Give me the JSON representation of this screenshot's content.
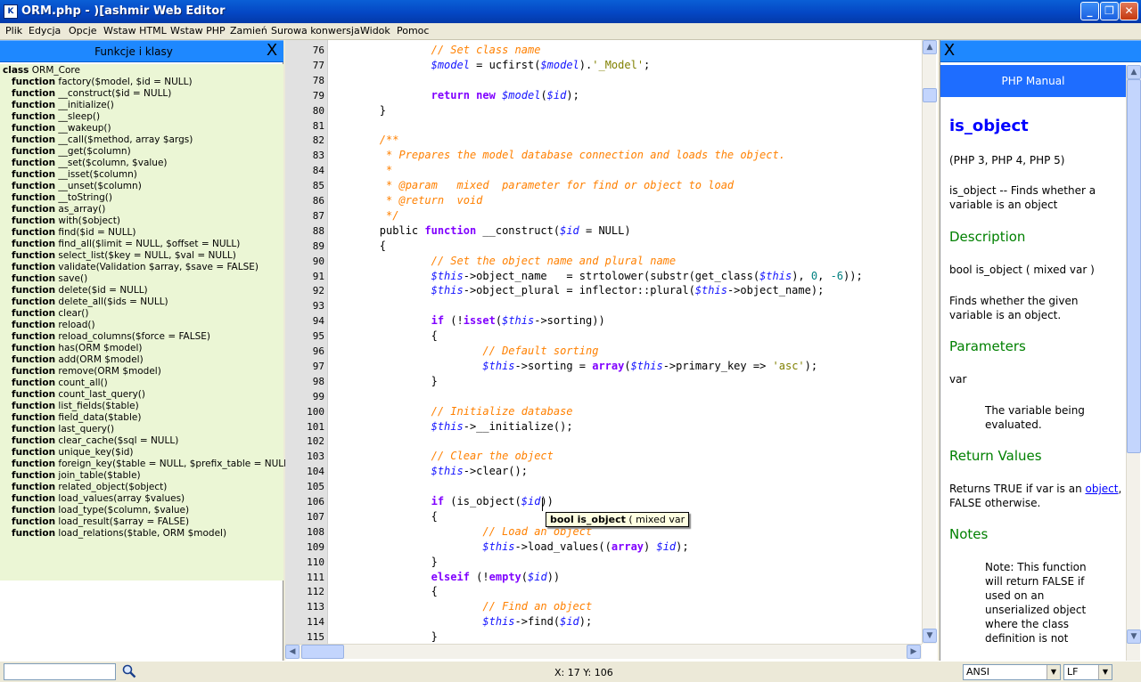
{
  "window": {
    "title": "ORM.php - )[ashmir Web Editor",
    "app_icon": "K",
    "minimize": "_",
    "maximize": "❐",
    "close": "✕"
  },
  "menu": [
    "Plik",
    "Edycja",
    "Opcje",
    "Wstaw HTML",
    "Wstaw PHP",
    "Zamień",
    "Surowa konwersja",
    "Widok",
    "Pomoc"
  ],
  "left_panel": {
    "title": "Funkcje i klasy",
    "close": "X",
    "class_keyword": "class",
    "class_name": "ORM_Core",
    "function_keyword": "function",
    "functions": [
      "factory($model, $id = NULL)",
      "__construct($id = NULL)",
      "__initialize()",
      "__sleep()",
      "__wakeup()",
      "__call($method, array $args)",
      "__get($column)",
      "__set($column, $value)",
      "__isset($column)",
      "__unset($column)",
      "__toString()",
      "as_array()",
      "with($object)",
      "find($id = NULL)",
      "find_all($limit = NULL, $offset = NULL)",
      "select_list($key = NULL, $val = NULL)",
      "validate(Validation $array, $save = FALSE)",
      "save()",
      "delete($id = NULL)",
      "delete_all($ids = NULL)",
      "clear()",
      "reload()",
      "reload_columns($force = FALSE)",
      "has(ORM $model)",
      "add(ORM $model)",
      "remove(ORM $model)",
      "count_all()",
      "count_last_query()",
      "list_fields($table)",
      "field_data($table)",
      "last_query()",
      "clear_cache($sql = NULL)",
      "unique_key($id)",
      "foreign_key($table = NULL, $prefix_table = NULL)",
      "join_table($table)",
      "related_object($object)",
      "load_values(array $values)",
      "load_type($column, $value)",
      "load_result($array = FALSE)",
      "load_relations($table, ORM $model)"
    ]
  },
  "editor": {
    "lines": [
      {
        "n": "76",
        "t": [
          [
            "cmt",
            "                // Set class name"
          ]
        ]
      },
      {
        "n": "77",
        "t": [
          [
            "p",
            "                "
          ],
          [
            "var",
            "$model"
          ],
          [
            "p",
            " = ucfirst("
          ],
          [
            "var",
            "$model"
          ],
          [
            "p",
            ")."
          ],
          [
            "str",
            "'_Model'"
          ],
          [
            "p",
            ";"
          ]
        ]
      },
      {
        "n": "78",
        "t": []
      },
      {
        "n": "79",
        "t": [
          [
            "p",
            "                "
          ],
          [
            "kw",
            "return new"
          ],
          [
            "p",
            " "
          ],
          [
            "var",
            "$model"
          ],
          [
            "p",
            "("
          ],
          [
            "var",
            "$id"
          ],
          [
            "p",
            ");"
          ]
        ]
      },
      {
        "n": "80",
        "t": [
          [
            "p",
            "        }"
          ]
        ]
      },
      {
        "n": "81",
        "t": []
      },
      {
        "n": "82",
        "t": [
          [
            "cmt",
            "        /**"
          ]
        ]
      },
      {
        "n": "83",
        "t": [
          [
            "cmt",
            "         * Prepares the model database connection and loads the object."
          ]
        ]
      },
      {
        "n": "84",
        "t": [
          [
            "cmt",
            "         *"
          ]
        ]
      },
      {
        "n": "85",
        "t": [
          [
            "cmt",
            "         * @param   mixed  parameter for find or object to load"
          ]
        ]
      },
      {
        "n": "86",
        "t": [
          [
            "cmt",
            "         * @return  void"
          ]
        ]
      },
      {
        "n": "87",
        "t": [
          [
            "cmt",
            "         */"
          ]
        ]
      },
      {
        "n": "88",
        "t": [
          [
            "p",
            "        public "
          ],
          [
            "kw",
            "function"
          ],
          [
            "p",
            " __construct("
          ],
          [
            "var",
            "$id"
          ],
          [
            "p",
            " = NULL)"
          ]
        ]
      },
      {
        "n": "89",
        "t": [
          [
            "p",
            "        {"
          ]
        ]
      },
      {
        "n": "90",
        "t": [
          [
            "cmt",
            "                // Set the object name and plural name"
          ]
        ]
      },
      {
        "n": "91",
        "t": [
          [
            "p",
            "                "
          ],
          [
            "var",
            "$this"
          ],
          [
            "p",
            "->object_name   = strtolower(substr(get_class("
          ],
          [
            "var",
            "$this"
          ],
          [
            "p",
            "), "
          ],
          [
            "num",
            "0"
          ],
          [
            "p",
            ", "
          ],
          [
            "num",
            "-6"
          ],
          [
            "p",
            "));"
          ]
        ]
      },
      {
        "n": "92",
        "t": [
          [
            "p",
            "                "
          ],
          [
            "var",
            "$this"
          ],
          [
            "p",
            "->object_plural = inflector::plural("
          ],
          [
            "var",
            "$this"
          ],
          [
            "p",
            "->object_name);"
          ]
        ]
      },
      {
        "n": "93",
        "t": []
      },
      {
        "n": "94",
        "t": [
          [
            "p",
            "                "
          ],
          [
            "kw",
            "if"
          ],
          [
            "p",
            " (!"
          ],
          [
            "kw",
            "isset"
          ],
          [
            "p",
            "("
          ],
          [
            "var",
            "$this"
          ],
          [
            "p",
            "->sorting))"
          ]
        ]
      },
      {
        "n": "95",
        "t": [
          [
            "p",
            "                {"
          ]
        ]
      },
      {
        "n": "96",
        "t": [
          [
            "cmt",
            "                        // Default sorting"
          ]
        ]
      },
      {
        "n": "97",
        "t": [
          [
            "p",
            "                        "
          ],
          [
            "var",
            "$this"
          ],
          [
            "p",
            "->sorting = "
          ],
          [
            "kw",
            "array"
          ],
          [
            "p",
            "("
          ],
          [
            "var",
            "$this"
          ],
          [
            "p",
            "->primary_key => "
          ],
          [
            "str",
            "'asc'"
          ],
          [
            "p",
            ");"
          ]
        ]
      },
      {
        "n": "98",
        "t": [
          [
            "p",
            "                }"
          ]
        ]
      },
      {
        "n": "99",
        "t": []
      },
      {
        "n": "100",
        "t": [
          [
            "cmt",
            "                // Initialize database"
          ]
        ]
      },
      {
        "n": "101",
        "t": [
          [
            "p",
            "                "
          ],
          [
            "var",
            "$this"
          ],
          [
            "p",
            "->__initialize();"
          ]
        ]
      },
      {
        "n": "102",
        "t": []
      },
      {
        "n": "103",
        "t": [
          [
            "cmt",
            "                // Clear the object"
          ]
        ]
      },
      {
        "n": "104",
        "t": [
          [
            "p",
            "                "
          ],
          [
            "var",
            "$this"
          ],
          [
            "p",
            "->clear();"
          ]
        ]
      },
      {
        "n": "105",
        "t": []
      },
      {
        "n": "106",
        "t": [
          [
            "p",
            "                "
          ],
          [
            "kw",
            "if"
          ],
          [
            "p",
            " (is_object("
          ],
          [
            "var",
            "$id"
          ],
          [
            "p",
            "))"
          ]
        ]
      },
      {
        "n": "107",
        "t": [
          [
            "p",
            "                {"
          ]
        ]
      },
      {
        "n": "108",
        "t": [
          [
            "cmt",
            "                        // Load an object"
          ]
        ]
      },
      {
        "n": "109",
        "t": [
          [
            "p",
            "                        "
          ],
          [
            "var",
            "$this"
          ],
          [
            "p",
            "->load_values(("
          ],
          [
            "kw",
            "array"
          ],
          [
            "p",
            ") "
          ],
          [
            "var",
            "$id"
          ],
          [
            "p",
            ");"
          ]
        ]
      },
      {
        "n": "110",
        "t": [
          [
            "p",
            "                }"
          ]
        ]
      },
      {
        "n": "111",
        "t": [
          [
            "p",
            "                "
          ],
          [
            "kw",
            "elseif"
          ],
          [
            "p",
            " (!"
          ],
          [
            "kw",
            "empty"
          ],
          [
            "p",
            "("
          ],
          [
            "var",
            "$id"
          ],
          [
            "p",
            "))"
          ]
        ]
      },
      {
        "n": "112",
        "t": [
          [
            "p",
            "                {"
          ]
        ]
      },
      {
        "n": "113",
        "t": [
          [
            "cmt",
            "                        // Find an object"
          ]
        ]
      },
      {
        "n": "114",
        "t": [
          [
            "p",
            "                        "
          ],
          [
            "var",
            "$this"
          ],
          [
            "p",
            "->find("
          ],
          [
            "var",
            "$id"
          ],
          [
            "p",
            ");"
          ]
        ]
      },
      {
        "n": "115",
        "t": [
          [
            "p",
            "                }"
          ]
        ]
      }
    ],
    "tooltip_bold": "bool is_object",
    "tooltip_rest": " ( mixed var"
  },
  "manual": {
    "close": "X",
    "header": "PHP Manual",
    "title": "is_object",
    "versions": "(PHP 3, PHP 4, PHP 5)",
    "summary": "is_object -- Finds whether a variable is an object",
    "h_description": "Description",
    "signature": "bool is_object ( mixed var )",
    "description": "Finds whether the given variable is an object.",
    "h_parameters": "Parameters",
    "param_name": "var",
    "param_desc": "The variable being evaluated.",
    "h_return": "Return Values",
    "return_pre": "Returns TRUE if var is an ",
    "return_link": "object",
    "return_post": ", FALSE otherwise.",
    "h_notes": "Notes",
    "note": "Note: This function will return FALSE if used on an unserialized object where the class definition is not"
  },
  "status": {
    "search_value": "",
    "coords": "X: 17 Y: 106",
    "encoding": "ANSI",
    "line_ending": "LF"
  },
  "colors": {
    "panel_header": "#1e88ff",
    "manual_header": "#1e6dff",
    "function_list_bg": "#ebf6d5",
    "comment": "#ff8000",
    "keyword": "#8000ff",
    "variable": "#1414ff"
  }
}
